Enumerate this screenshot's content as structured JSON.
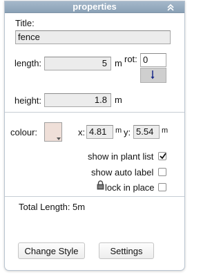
{
  "window": {
    "title": "properties"
  },
  "title_section": {
    "label": "Title:",
    "value": "fence"
  },
  "dimensions": {
    "length_label": "length:",
    "length_value": "5",
    "length_unit": "m",
    "rot_label": "rot:",
    "rot_value": "0",
    "height_label": "height:",
    "height_value": "1.8",
    "height_unit": "m"
  },
  "style": {
    "colour_label": "colour:",
    "swatch_color": "#efdfd8",
    "x_label": "x:",
    "x_value": "4.81",
    "x_unit": "m",
    "y_label": "y:",
    "y_value": "5.54",
    "y_unit": "m"
  },
  "options": [
    {
      "label": "show in plant list",
      "checked": true
    },
    {
      "label": "show auto label",
      "checked": false
    },
    {
      "label": "lock in place",
      "checked": false,
      "icon": "padlock-icon"
    }
  ],
  "summary": {
    "total_length": "Total Length: 5m"
  },
  "buttons": {
    "change_style": "Change Style",
    "settings": "Settings"
  },
  "colors": {
    "titlebar": "#94a9bd",
    "border": "#b9c4d0",
    "field_bg": "#ececec",
    "rotation_indicator": "#1a2a8a"
  }
}
